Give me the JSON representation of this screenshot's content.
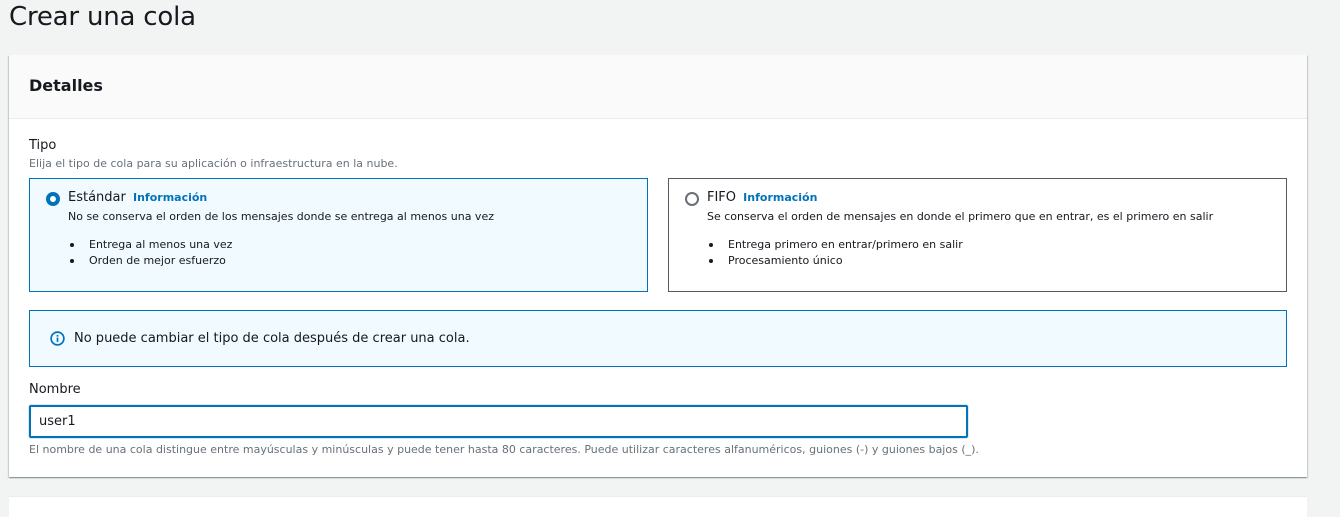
{
  "page": {
    "title": "Crear una cola"
  },
  "details": {
    "header": "Detalles",
    "type": {
      "label": "Tipo",
      "description": "Elija el tipo de cola para su aplicación o infraestructura en la nube.",
      "options": [
        {
          "title": "Estándar",
          "info": "Información",
          "description": "No se conserva el orden de los mensajes donde se entrega al menos una vez",
          "bullets": [
            "Entrega al menos una vez",
            "Orden de mejor esfuerzo"
          ],
          "selected": true
        },
        {
          "title": "FIFO",
          "info": "Información",
          "description": "Se conserva el orden de mensajes en donde el primero que en entrar, es el primero en salir",
          "bullets": [
            "Entrega primero en entrar/primero en salir",
            "Procesamiento único"
          ],
          "selected": false
        }
      ]
    },
    "alert": {
      "icon": "info-icon",
      "text": "No puede cambiar el tipo de cola después de crear una cola."
    },
    "name": {
      "label": "Nombre",
      "value": "user1",
      "hint": "El nombre de una cola distingue entre mayúsculas y minúsculas y puede tener hasta 80 caracteres. Puede utilizar caracteres alfanuméricos, guiones (-) y guiones bajos (_)."
    }
  },
  "colors": {
    "accent": "#0073bb",
    "selected_bg": "#f1faff",
    "page_bg": "#f2f3f3"
  }
}
